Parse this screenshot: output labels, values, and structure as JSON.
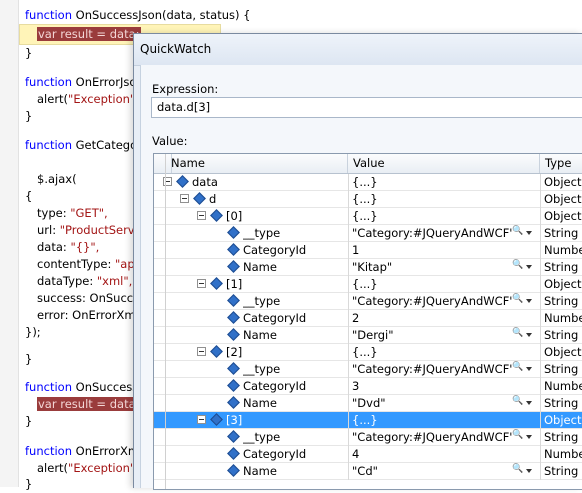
{
  "code": {
    "l1": {
      "kw": "function",
      "rest": " OnSuccessJson(data, status) {"
    },
    "l2": {
      "hl": "var result = data;"
    },
    "l3": "}",
    "l4": {
      "kw": "function",
      "rest": " OnErrorJso",
      "kw2": "alert(",
      "str": "\"Exception\""
    },
    "l5": {
      "indent": "alert(",
      "str": "\"Exception\""
    },
    "l6": "}",
    "l7": {
      "kw": "function",
      "rest": " GetCategor"
    },
    "l8": "$.ajax(",
    "l9": "{",
    "l10": {
      "a": "type: ",
      "str": "\"GET\","
    },
    "l11": {
      "a": "url: ",
      "str": "\"ProductServ"
    },
    "l12": {
      "a": "data: ",
      "str": "\"{}\","
    },
    "l13": {
      "a": "contentType: ",
      "str": "\"app"
    },
    "l14": {
      "a": "dataType: ",
      "str": "\"xml\","
    },
    "l15": "success: OnSucce",
    "l16": "error: OnErrorXm",
    "l17": "});",
    "l18": "}",
    "l19": {
      "kw": "function",
      "rest": " OnSuccess"
    },
    "l20": {
      "hl": "var result = data;"
    },
    "l21": "}",
    "l22": {
      "kw": "function",
      "rest": " OnErrorXm"
    },
    "l23": {
      "a": "alert(",
      "str": "\"Exception\"",
      "b": ")"
    },
    "l24": "}"
  },
  "quickwatch": {
    "title": "QuickWatch",
    "expression_label": "Expression:",
    "expression_value": "data.d[3]",
    "value_label": "Value:",
    "columns": {
      "name": "Name",
      "value": "Value",
      "type": "Type"
    },
    "rows": [
      {
        "name": "data",
        "value": "{...}",
        "type": "Object"
      },
      {
        "name": "d",
        "value": "{...}",
        "type": "Object"
      },
      {
        "name": "[0]",
        "value": "{...}",
        "type": "Object"
      },
      {
        "name": "__type",
        "value": "\"Category:#JQueryAndWCF\"",
        "type": "String"
      },
      {
        "name": "CategoryId",
        "value": "1",
        "type": "Number"
      },
      {
        "name": "Name",
        "value": "\"Kitap\"",
        "type": "String"
      },
      {
        "name": "[1]",
        "value": "{...}",
        "type": "Object"
      },
      {
        "name": "__type",
        "value": "\"Category:#JQueryAndWCF\"",
        "type": "String"
      },
      {
        "name": "CategoryId",
        "value": "2",
        "type": "Number"
      },
      {
        "name": "Name",
        "value": "\"Dergi\"",
        "type": "String"
      },
      {
        "name": "[2]",
        "value": "{...}",
        "type": "Object"
      },
      {
        "name": "__type",
        "value": "\"Category:#JQueryAndWCF\"",
        "type": "String"
      },
      {
        "name": "CategoryId",
        "value": "3",
        "type": "Number"
      },
      {
        "name": "Name",
        "value": "\"Dvd\"",
        "type": "String"
      },
      {
        "name": "[3]",
        "value": "{...}",
        "type": "Object"
      },
      {
        "name": "__type",
        "value": "\"Category:#JQueryAndWCF\"",
        "type": "String"
      },
      {
        "name": "CategoryId",
        "value": "4",
        "type": "Number"
      },
      {
        "name": "Name",
        "value": "\"Cd\"",
        "type": "String"
      }
    ]
  }
}
